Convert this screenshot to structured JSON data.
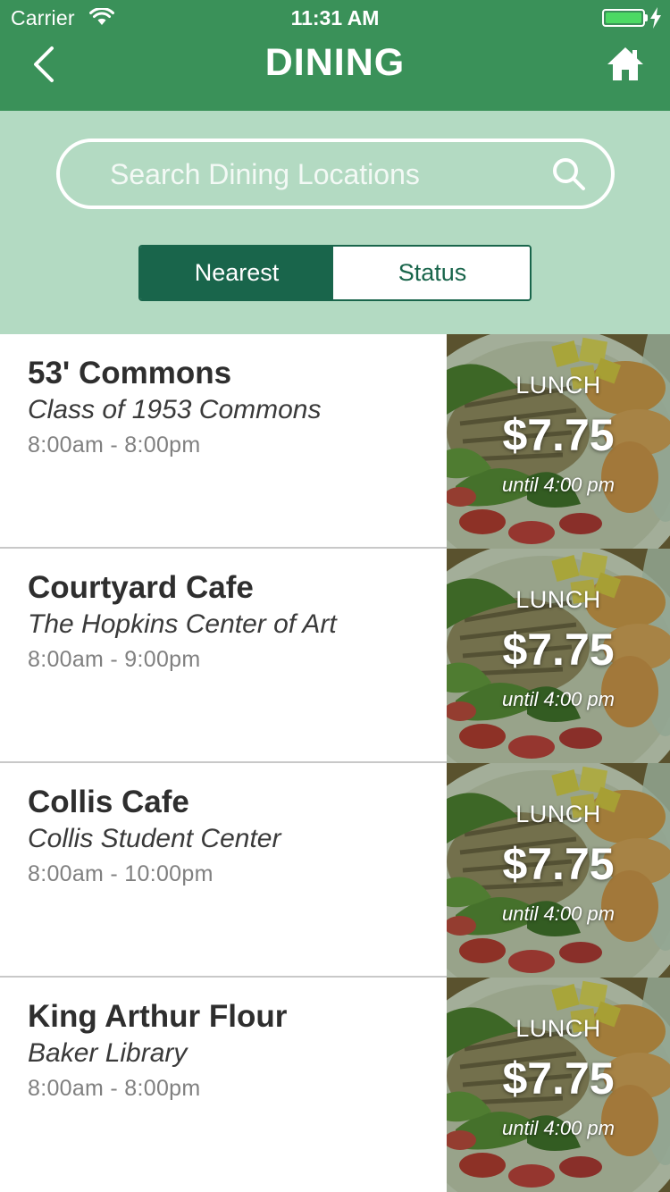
{
  "status_bar": {
    "carrier": "Carrier",
    "time": "11:31 AM",
    "battery_color": "#4cd964"
  },
  "nav": {
    "title": "DINING",
    "back_icon": "chevron-left-icon",
    "home_icon": "home-icon",
    "background_color": "#3a9159"
  },
  "search": {
    "placeholder": "Search Dining Locations",
    "value": "",
    "icon": "search-icon"
  },
  "segments": {
    "options": [
      "Nearest",
      "Status"
    ],
    "selected": "Nearest",
    "accent_color": "#19654b"
  },
  "locations": [
    {
      "name": "53' Commons",
      "building": "Class of 1953 Commons",
      "hours": "8:00am - 8:00pm",
      "meal": {
        "label": "LUNCH",
        "price": "$7.75",
        "until": "until 4:00 pm"
      }
    },
    {
      "name": "Courtyard Cafe",
      "building": "The Hopkins Center of Art",
      "hours": "8:00am - 9:00pm",
      "meal": {
        "label": "LUNCH",
        "price": "$7.75",
        "until": "until 4:00 pm"
      }
    },
    {
      "name": "Collis Cafe",
      "building": "Collis Student Center",
      "hours": "8:00am - 10:00pm",
      "meal": {
        "label": "LUNCH",
        "price": "$7.75",
        "until": "until 4:00 pm"
      }
    },
    {
      "name": "King Arthur Flour",
      "building": "Baker Library",
      "hours": "8:00am - 8:00pm",
      "meal": {
        "label": "LUNCH",
        "price": "$7.75",
        "until": "until 4:00 pm"
      }
    }
  ]
}
